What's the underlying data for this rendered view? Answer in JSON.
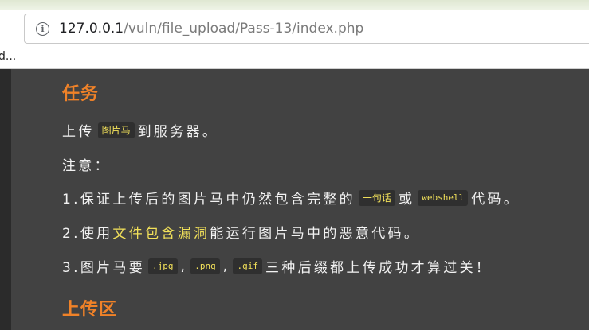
{
  "browser": {
    "url_host": "127.0.0.1",
    "url_path": "/vuln/file_upload/Pass-13/index.php",
    "bookmark_label": "d..."
  },
  "task": {
    "heading": "任务",
    "line1_prefix": "上传",
    "line1_code": "图片马",
    "line1_suffix": "到服务器。",
    "notice_label": "注意：",
    "item1_prefix": "1.保证上传后的图片马中仍然包含完整的",
    "item1_code_a": "一句话",
    "item1_mid": "或",
    "item1_code_b": "webshell",
    "item1_suffix": "代码。",
    "item2_prefix": "2.使用",
    "item2_link": "文件包含漏洞",
    "item2_suffix": "能运行图片马中的恶意代码。",
    "item3_prefix": "3.图片马要",
    "item3_code_a": ".jpg",
    "item3_sep1": ",",
    "item3_code_b": ".png",
    "item3_sep2": ",",
    "item3_code_c": ".gif",
    "item3_suffix": "三种后缀都上传成功才算过关！"
  },
  "upload": {
    "heading": "上传区"
  },
  "colors": {
    "heading_orange": "#f08228",
    "highlight_yellow": "#f2e15a",
    "page_background": "#424242"
  }
}
